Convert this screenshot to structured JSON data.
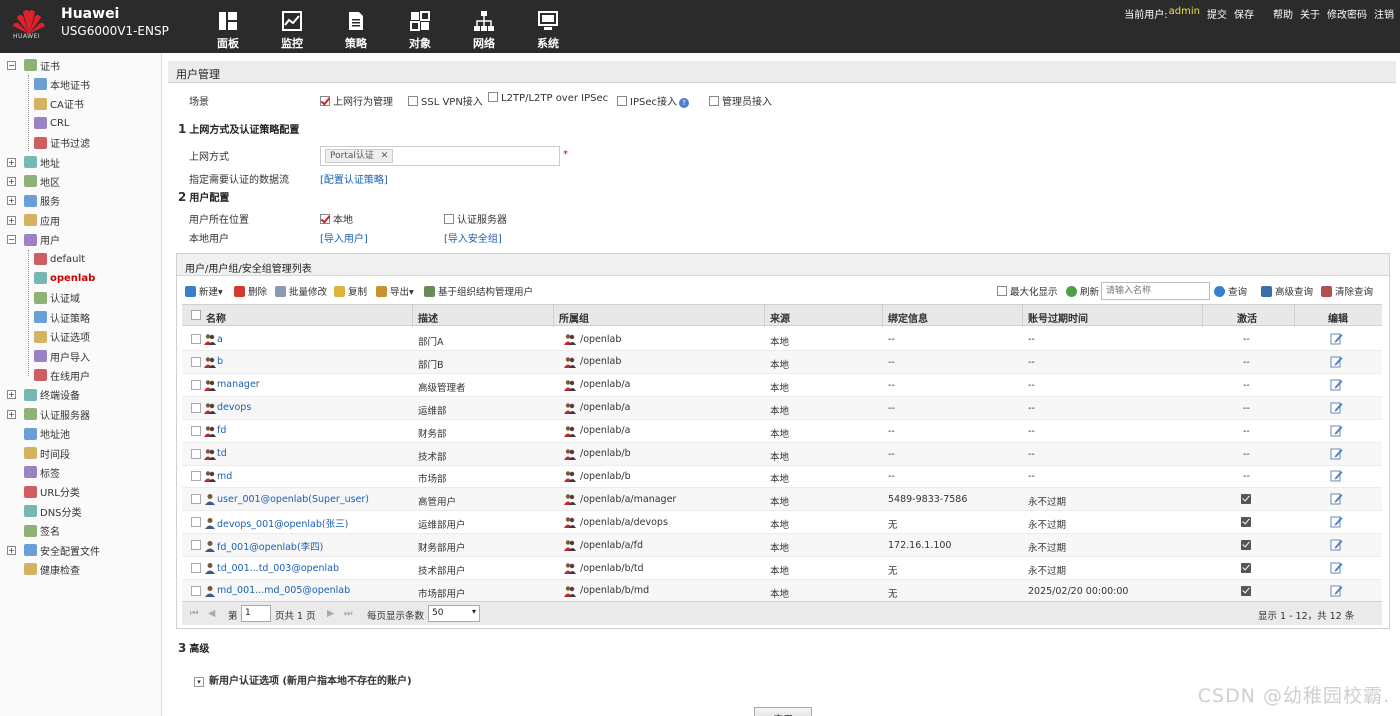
{
  "header": {
    "logo_text": "HUAWEI",
    "brand": "Huawei",
    "model": "USG6000V1-ENSP",
    "nav": [
      {
        "label": "面板",
        "icon": "dashboard-icon"
      },
      {
        "label": "监控",
        "icon": "monitor-icon"
      },
      {
        "label": "策略",
        "icon": "policy-icon"
      },
      {
        "label": "对象",
        "icon": "object-icon"
      },
      {
        "label": "网络",
        "icon": "network-icon"
      },
      {
        "label": "系统",
        "icon": "system-icon"
      }
    ],
    "current_user_label": "当前用户:",
    "current_user": "admin",
    "links": [
      "提交",
      "保存",
      "帮助",
      "关于",
      "修改密码",
      "注销"
    ]
  },
  "sidebar": {
    "items": [
      {
        "label": "证书",
        "level": 0,
        "expander": "−"
      },
      {
        "label": "本地证书",
        "level": 1
      },
      {
        "label": "CA证书",
        "level": 1
      },
      {
        "label": "CRL",
        "level": 1
      },
      {
        "label": "证书过滤",
        "level": 1
      },
      {
        "label": "地址",
        "level": 0,
        "expander": "+"
      },
      {
        "label": "地区",
        "level": 0,
        "expander": "+"
      },
      {
        "label": "服务",
        "level": 0,
        "expander": "+"
      },
      {
        "label": "应用",
        "level": 0,
        "expander": "+"
      },
      {
        "label": "用户",
        "level": 0,
        "expander": "−"
      },
      {
        "label": "default",
        "level": 1
      },
      {
        "label": "openlab",
        "level": 1,
        "active": true
      },
      {
        "label": "认证域",
        "level": 1
      },
      {
        "label": "认证策略",
        "level": 1
      },
      {
        "label": "认证选项",
        "level": 1
      },
      {
        "label": "用户导入",
        "level": 1
      },
      {
        "label": "在线用户",
        "level": 1
      },
      {
        "label": "终端设备",
        "level": 0,
        "expander": "+"
      },
      {
        "label": "认证服务器",
        "level": 0,
        "expander": "+"
      },
      {
        "label": "地址池",
        "level": 0
      },
      {
        "label": "时间段",
        "level": 0
      },
      {
        "label": "标签",
        "level": 0
      },
      {
        "label": "URL分类",
        "level": 0
      },
      {
        "label": "DNS分类",
        "level": 0
      },
      {
        "label": "签名",
        "level": 0
      },
      {
        "label": "安全配置文件",
        "level": 0,
        "expander": "+"
      },
      {
        "label": "健康检查",
        "level": 0
      }
    ]
  },
  "main": {
    "page_title": "用户管理",
    "scene_label": "场景",
    "scenes": [
      {
        "label": "上网行为管理",
        "checked": true
      },
      {
        "label": "SSL VPN接入",
        "checked": false
      },
      {
        "label": "L2TP/L2TP over IPSec",
        "checked": false
      },
      {
        "label": "IPSec接入",
        "checked": false
      },
      {
        "label": "管理员接入",
        "checked": false
      }
    ],
    "section1": {
      "num": "1",
      "title": "上网方式及认证策略配置"
    },
    "access_label": "上网方式",
    "access_tag": "Portal认证",
    "flow_label": "指定需要认证的数据流",
    "flow_link": "[配置认证策略]",
    "section2": {
      "num": "2",
      "title": "用户配置"
    },
    "location_label": "用户所在位置",
    "location_local": "本地",
    "location_server": "认证服务器",
    "local_user_label": "本地用户",
    "import_user": "[导入用户]",
    "import_group": "[导入安全组]",
    "section3": {
      "num": "3",
      "title": "高级"
    },
    "advanced_option": "新用户认证选项 (新用户指本地不存在的账户)",
    "apply_label": "应用"
  },
  "table": {
    "title": "用户/用户组/安全组管理列表",
    "toolbar": {
      "new": "新建▾",
      "delete": "删除",
      "batch_edit": "批量修改",
      "copy": "复制",
      "export": "导出▾",
      "org_manage": "基于组织结构管理用户",
      "maximize": "最大化显示",
      "refresh": "刷新",
      "search_placeholder": "请输入名称",
      "query": "查询",
      "advanced_query": "高级查询",
      "clear_query": "清除查询"
    },
    "columns": [
      "名称",
      "描述",
      "所属组",
      "来源",
      "绑定信息",
      "账号过期时间",
      "激活",
      "编辑"
    ],
    "rows": [
      {
        "name": "a",
        "type": "group",
        "desc": "部门A",
        "group": "/openlab",
        "source": "本地",
        "bind": "--",
        "expire": "--",
        "active": "--"
      },
      {
        "name": "b",
        "type": "group",
        "desc": "部门B",
        "group": "/openlab",
        "source": "本地",
        "bind": "--",
        "expire": "--",
        "active": "--"
      },
      {
        "name": "manager",
        "type": "group",
        "desc": "高级管理者",
        "group": "/openlab/a",
        "source": "本地",
        "bind": "--",
        "expire": "--",
        "active": "--"
      },
      {
        "name": "devops",
        "type": "group",
        "desc": "运维部",
        "group": "/openlab/a",
        "source": "本地",
        "bind": "--",
        "expire": "--",
        "active": "--"
      },
      {
        "name": "fd",
        "type": "group",
        "desc": "财务部",
        "group": "/openlab/a",
        "source": "本地",
        "bind": "--",
        "expire": "--",
        "active": "--"
      },
      {
        "name": "td",
        "type": "group",
        "desc": "技术部",
        "group": "/openlab/b",
        "source": "本地",
        "bind": "--",
        "expire": "--",
        "active": "--"
      },
      {
        "name": "md",
        "type": "group",
        "desc": "市场部",
        "group": "/openlab/b",
        "source": "本地",
        "bind": "--",
        "expire": "--",
        "active": "--"
      },
      {
        "name": "user_001@openlab(Super_user)",
        "type": "user",
        "desc": "高管用户",
        "group": "/openlab/a/manager",
        "source": "本地",
        "bind": "5489-9833-7586",
        "expire": "永不过期",
        "active": "check"
      },
      {
        "name": "devops_001@openlab(张三)",
        "type": "user",
        "desc": "运维部用户",
        "group": "/openlab/a/devops",
        "source": "本地",
        "bind": "无",
        "expire": "永不过期",
        "active": "check"
      },
      {
        "name": "fd_001@openlab(李四)",
        "type": "user",
        "desc": "财务部用户",
        "group": "/openlab/a/fd",
        "source": "本地",
        "bind": "172.16.1.100",
        "expire": "永不过期",
        "active": "check"
      },
      {
        "name": "td_001...td_003@openlab",
        "type": "user",
        "desc": "技术部用户",
        "group": "/openlab/b/td",
        "source": "本地",
        "bind": "无",
        "expire": "永不过期",
        "active": "check"
      },
      {
        "name": "md_001...md_005@openlab",
        "type": "user",
        "desc": "市场部用户",
        "group": "/openlab/b/md",
        "source": "本地",
        "bind": "无",
        "expire": "2025/02/20 00:00:00",
        "active": "check"
      }
    ],
    "pager": {
      "page_prefix": "第",
      "page": "1",
      "page_suffix": "页共 1 页",
      "per_page_label": "每页显示条数",
      "per_page": "50",
      "summary": "显示 1 - 12，共 12 条"
    }
  },
  "watermark": "CSDN @幼稚园校霸.",
  "colors": {
    "topbar": "#2b2b2b",
    "accent_red": "#c0282d",
    "link": "#1a5fb4"
  }
}
